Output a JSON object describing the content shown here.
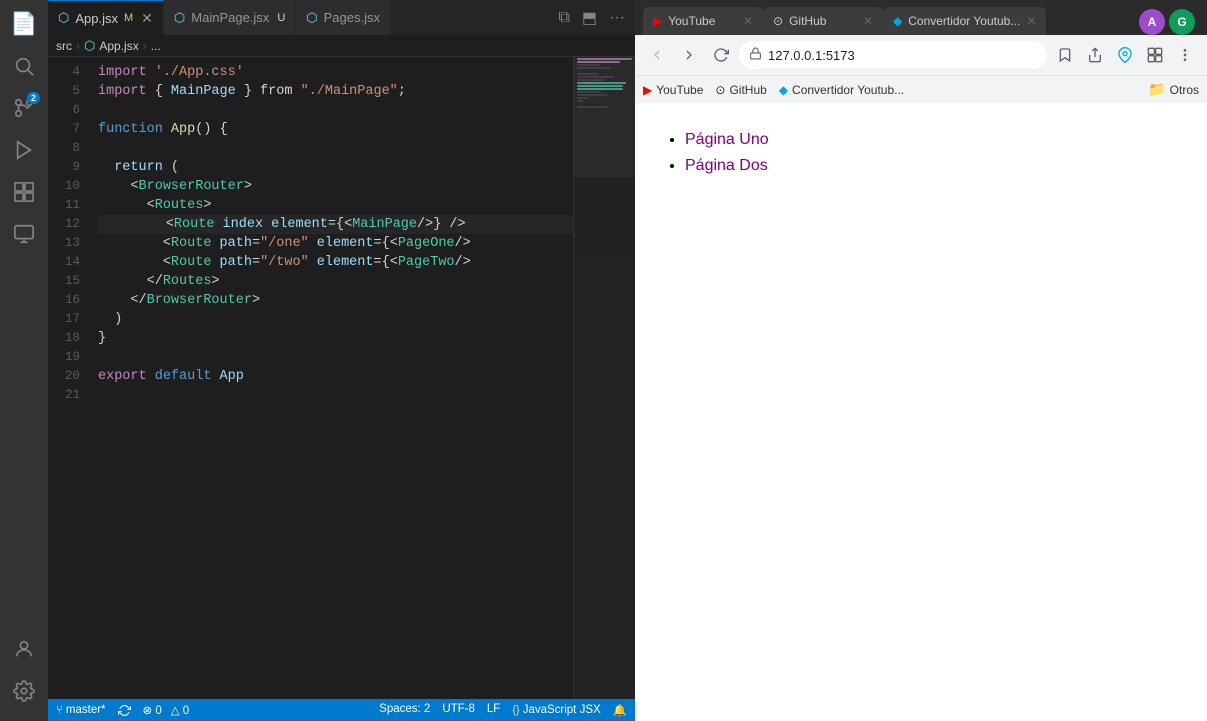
{
  "activityBar": {
    "icons": [
      {
        "name": "files-icon",
        "symbol": "⬜",
        "active": false
      },
      {
        "name": "search-icon",
        "symbol": "🔍",
        "active": false
      },
      {
        "name": "source-control-icon",
        "symbol": "⑂",
        "active": false,
        "badge": "2"
      },
      {
        "name": "run-icon",
        "symbol": "▷",
        "active": false
      },
      {
        "name": "extensions-icon",
        "symbol": "⊞",
        "active": false
      },
      {
        "name": "remote-explorer-icon",
        "symbol": "⊙",
        "active": false
      },
      {
        "name": "account-icon",
        "symbol": "◯",
        "bottom": true
      },
      {
        "name": "settings-icon",
        "symbol": "⚙",
        "bottom": true
      }
    ]
  },
  "editor": {
    "tabs": [
      {
        "label": "App.jsx",
        "modified": true,
        "active": true,
        "closable": true
      },
      {
        "label": "MainPage.jsx",
        "modified": true,
        "active": false,
        "closable": false
      },
      {
        "label": "Pages.jsx",
        "modified": false,
        "active": false,
        "closable": false
      }
    ],
    "breadcrumb": {
      "parts": [
        "src",
        "App.jsx",
        "..."
      ]
    },
    "lines": [
      {
        "num": 4,
        "content": "import './App.css'"
      },
      {
        "num": 5,
        "content": "import { MainPage } from \"./MainPage\";"
      },
      {
        "num": 6,
        "content": ""
      },
      {
        "num": 7,
        "content": "function App() {"
      },
      {
        "num": 8,
        "content": ""
      },
      {
        "num": 9,
        "content": "  return ("
      },
      {
        "num": 10,
        "content": "    <BrowserRouter>"
      },
      {
        "num": 11,
        "content": "      <Routes>"
      },
      {
        "num": 12,
        "content": "        <Route index element={<MainPage/>} />",
        "active": true
      },
      {
        "num": 13,
        "content": "        <Route path=\"/one\" element={<PageOne/>"
      },
      {
        "num": 14,
        "content": "        <Route path=\"/two\" element={<PageTwo/>"
      },
      {
        "num": 15,
        "content": "      </Routes>"
      },
      {
        "num": 16,
        "content": "    </BrowserRouter>"
      },
      {
        "num": 17,
        "content": "  )"
      },
      {
        "num": 18,
        "content": "}"
      },
      {
        "num": 19,
        "content": ""
      },
      {
        "num": 20,
        "content": "export default App"
      },
      {
        "num": 21,
        "content": ""
      }
    ],
    "statusBar": {
      "branch": "master*",
      "errors": "⊗ 0",
      "warnings": "△ 0",
      "spaces": "Spaces: 2",
      "encoding": "UTF-8",
      "lineEnding": "LF",
      "language": "JavaScript JSX",
      "sync": true
    }
  },
  "browser": {
    "tabs": [
      {
        "label": "YouTube",
        "active": false,
        "favicon": "▶"
      },
      {
        "label": "GitHub",
        "active": false,
        "favicon": "⊙"
      },
      {
        "label": "Convertidor Youtub...",
        "active": false,
        "favicon": "◆"
      }
    ],
    "nav": {
      "url": "127.0.0.1:5173",
      "canBack": false,
      "canForward": true,
      "canRefresh": true
    },
    "bookmarks": [
      {
        "label": "YouTube"
      },
      {
        "label": "GitHub"
      },
      {
        "label": "Convertidor Youtub..."
      }
    ],
    "bookmarksOtros": "Otros",
    "page": {
      "links": [
        {
          "text": "Página Uno",
          "href": "#"
        },
        {
          "text": "Página Dos",
          "href": "#"
        }
      ]
    },
    "profiles": [
      {
        "initial": "A",
        "color": "#9c4dcc"
      },
      {
        "initial": "G",
        "color": "#0f9d58"
      }
    ]
  }
}
